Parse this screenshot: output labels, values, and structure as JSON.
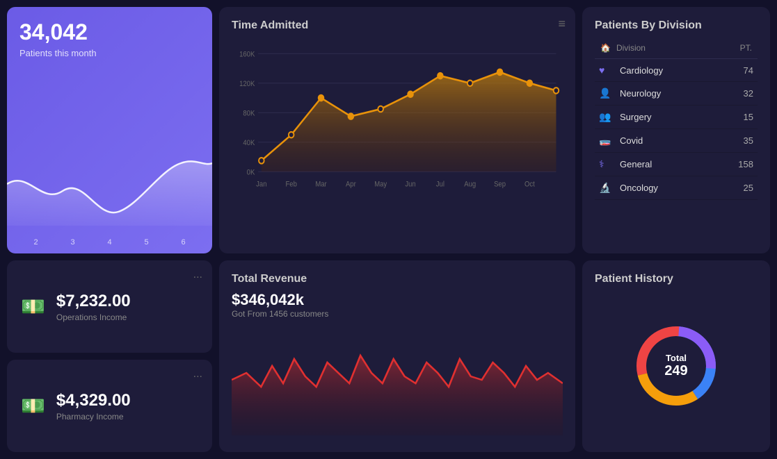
{
  "patients_card": {
    "big_number": "34,042",
    "subtitle": "Patients this month",
    "x_labels": [
      "2",
      "3",
      "4",
      "5",
      "6"
    ]
  },
  "time_admitted": {
    "title": "Time Admitted",
    "y_labels": [
      "160K",
      "120K",
      "80K",
      "40K",
      "0K"
    ],
    "x_labels": [
      "Jan",
      "Feb",
      "Mar",
      "Apr",
      "May",
      "Jun",
      "Jul",
      "Aug",
      "Sep",
      "Oct"
    ],
    "menu_icon": "≡"
  },
  "patients_by_division": {
    "title": "Patients By Division",
    "header_division": "Division",
    "header_pt": "PT.",
    "rows": [
      {
        "icon": "♥",
        "name": "Cardiology",
        "count": "74"
      },
      {
        "icon": "👤",
        "name": "Neurology",
        "count": "32"
      },
      {
        "icon": "👥",
        "name": "Surgery",
        "count": "15"
      },
      {
        "icon": "🧪",
        "name": "Covid",
        "count": "35"
      },
      {
        "icon": "⚕",
        "name": "General",
        "count": "158"
      },
      {
        "icon": "🔬",
        "name": "Oncology",
        "count": "25"
      }
    ]
  },
  "operations_income": {
    "amount": "$7,232.00",
    "label": "Operations Income",
    "icon": "💵",
    "dots": "..."
  },
  "pharmacy_income": {
    "amount": "$4,329.00",
    "label": "Pharmacy Income",
    "icon": "💵",
    "dots": "..."
  },
  "total_revenue": {
    "title": "Total Revenue",
    "amount": "$346,042k",
    "sub": "Got From 1456 customers"
  },
  "patient_history": {
    "title": "Patient History",
    "total_label": "Total",
    "total_value": "249",
    "donut": {
      "segments": [
        {
          "color": "#3b82f6",
          "value": 80
        },
        {
          "color": "#f59e0b",
          "value": 60
        },
        {
          "color": "#ef4444",
          "value": 60
        },
        {
          "color": "#8b5cf6",
          "value": 49
        }
      ]
    }
  }
}
